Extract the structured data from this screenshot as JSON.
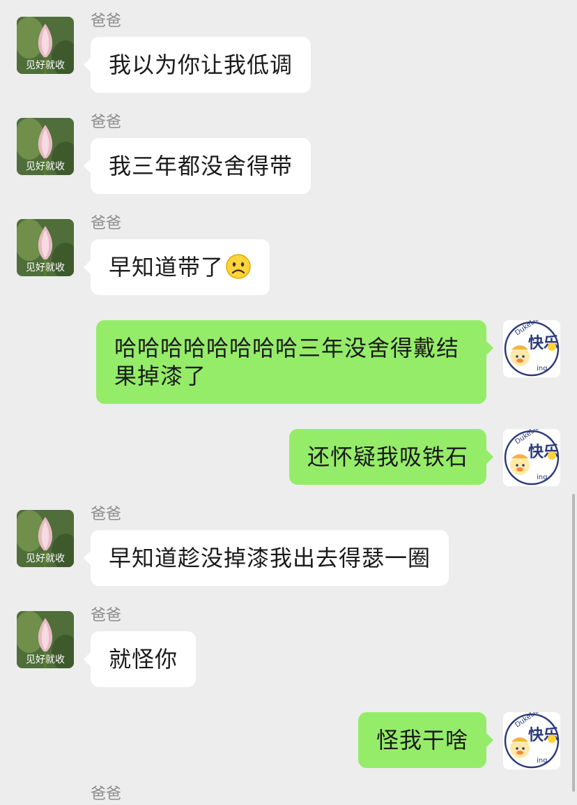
{
  "messages": [
    {
      "side": "left",
      "sender": "爸爸",
      "avatar_text": "见好就收",
      "text": "我以为你让我低调"
    },
    {
      "side": "left",
      "sender": "爸爸",
      "avatar_text": "见好就收",
      "text": "我三年都没舍得带"
    },
    {
      "side": "left",
      "sender": "爸爸",
      "avatar_text": "见好就收",
      "text": "早知道带了",
      "emoji": "frowning-face-emoji"
    },
    {
      "side": "right",
      "avatar_text": "快乐",
      "text": "哈哈哈哈哈哈哈哈三年没舍得戴结果掉漆了"
    },
    {
      "side": "right",
      "avatar_text": "快乐",
      "text": "还怀疑我吸铁石"
    },
    {
      "side": "left",
      "sender": "爸爸",
      "avatar_text": "见好就收",
      "text": "早知道趁没掉漆我出去得瑟一圈"
    },
    {
      "side": "left",
      "sender": "爸爸",
      "avatar_text": "见好就收",
      "text": "就怪你"
    },
    {
      "side": "right",
      "avatar_text": "快乐",
      "text": "怪我干啥"
    }
  ],
  "partial_sender": "爸爸",
  "colors": {
    "background": "#ededed",
    "left_bubble": "#ffffff",
    "right_bubble": "#95ec69",
    "sender_name": "#8c8c8c"
  }
}
